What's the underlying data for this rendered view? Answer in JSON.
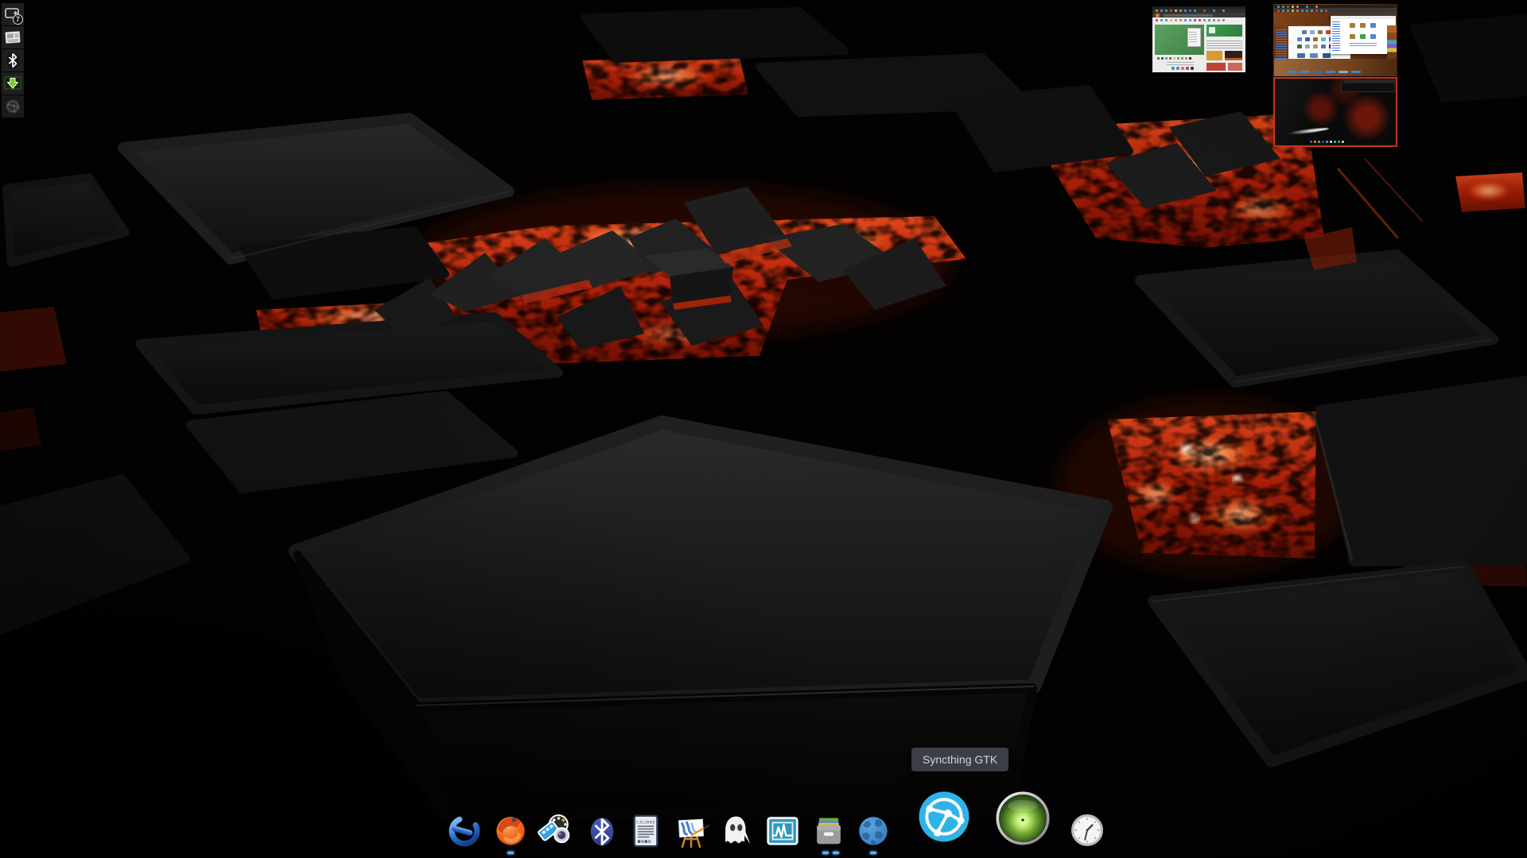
{
  "wallpaper": {
    "name": "lava-cubes-3d",
    "description_colors": {
      "tile_top": "#232323",
      "tile_side": "#0a0a0a",
      "lava_core": "#ff6a2e",
      "lava_deep": "#8a1505"
    }
  },
  "systray": {
    "items": [
      {
        "id": "screenshot-tool",
        "icon": "screenshot-plus-icon",
        "badge": "7"
      },
      {
        "id": "news-reader",
        "icon": "newspaper-icon"
      },
      {
        "id": "bluetooth-tray",
        "icon": "bluetooth-icon"
      },
      {
        "id": "download-manager",
        "icon": "green-download-arrow-icon"
      },
      {
        "id": "syncthing-tray-inactive",
        "icon": "syncthing-dim-icon"
      }
    ]
  },
  "pager": {
    "workspaces": [
      {
        "id": "workspace-1",
        "content": "maximized-browser-window"
      },
      {
        "id": "workspace-2",
        "content": "browser-and-file-manager-windows"
      },
      {
        "id": "workspace-active",
        "content": "current-desktop-with-dock",
        "active": true,
        "border_color": "#c8341d"
      }
    ]
  },
  "dock": {
    "items": [
      {
        "id": "launcher",
        "icon": "enlightenment-e-icon"
      },
      {
        "id": "firefox",
        "icon": "firefox-icon",
        "running_indicators": 1
      },
      {
        "id": "media-player",
        "icon": "media-player-icon"
      },
      {
        "id": "bluetooth",
        "icon": "bluetooth-icon"
      },
      {
        "id": "calibre-viewer",
        "icon": "ebook-reader-icon",
        "screen_label": "CALIBRE"
      },
      {
        "id": "mypaint",
        "icon": "easel-paint-icon"
      },
      {
        "id": "ghostwriter",
        "icon": "ghost-icon"
      },
      {
        "id": "system-monitor",
        "icon": "waveform-monitor-icon"
      },
      {
        "id": "file-cabinet",
        "icon": "file-cabinet-icon",
        "running_indicators": 2
      },
      {
        "id": "web-browser",
        "icon": "globe-icon",
        "running_indicators": 1
      },
      {
        "id": "syncthing-gtk",
        "icon": "syncthing-icon",
        "magnified": true
      },
      {
        "id": "green-orb-app",
        "icon": "green-orb-icon",
        "magnified": true
      },
      {
        "id": "clock",
        "icon": "analog-clock-icon"
      }
    ],
    "tooltip": {
      "text": "Syncthing GTK",
      "target": "syncthing-gtk"
    }
  },
  "colors": {
    "active_workspace_border": "#c8341d",
    "tooltip_bg": "#3a3e45",
    "tooltip_text": "#d2d6dc",
    "running_indicator": "#5db2ff",
    "syncthing_blue": "#2fb3e6"
  }
}
